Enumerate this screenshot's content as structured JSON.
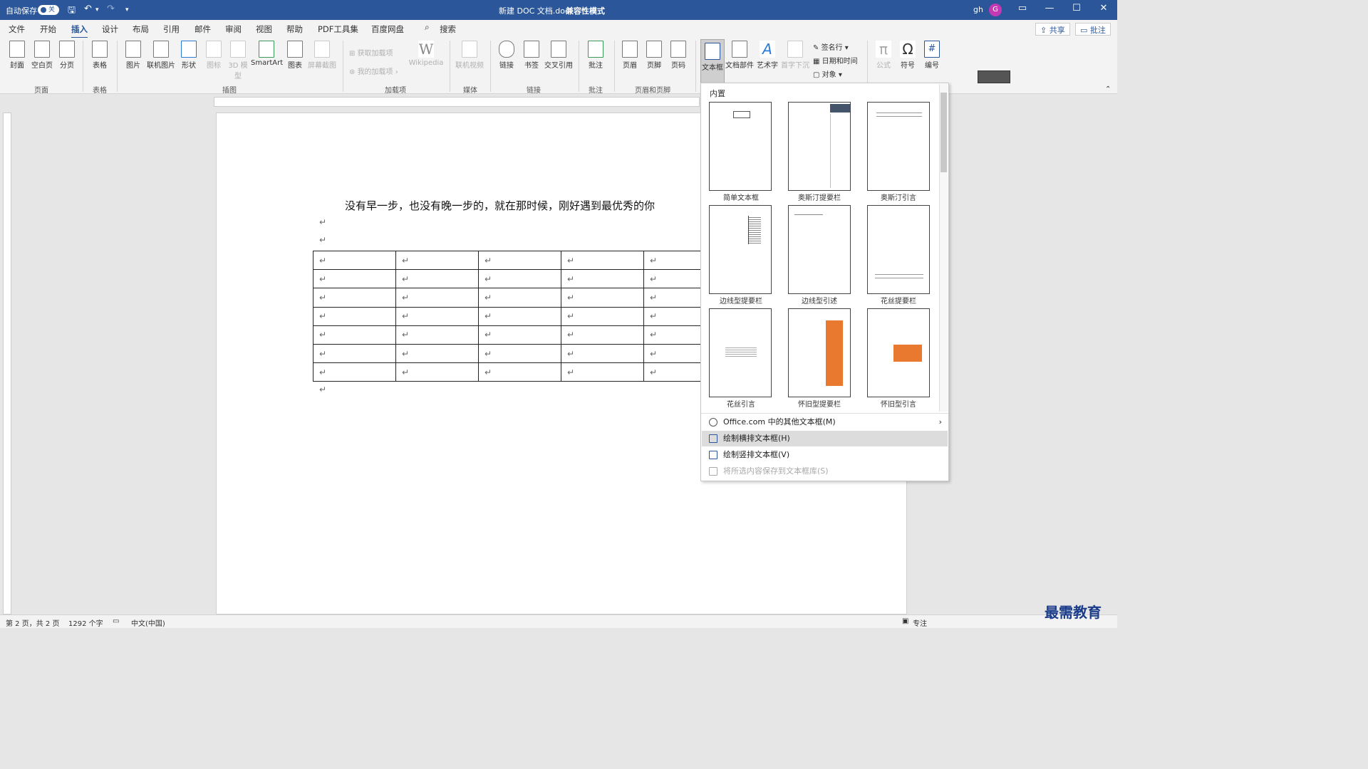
{
  "title_bar": {
    "autosave_label": "自动保存",
    "autosave_state": "关",
    "doc_title": "新建 DOC 文档.doc",
    "mode": "兼容性模式",
    "user": "gh",
    "avatar_letter": "G"
  },
  "menu": [
    "文件",
    "开始",
    "插入",
    "设计",
    "布局",
    "引用",
    "邮件",
    "审阅",
    "视图",
    "帮助",
    "PDF工具集",
    "百度网盘"
  ],
  "search_label": "搜索",
  "share_label": "共享",
  "comment_label": "批注",
  "ribbon": {
    "buttons": [
      {
        "label": "封面"
      },
      {
        "label": "空白页"
      },
      {
        "label": "分页"
      },
      {
        "label": "表格"
      },
      {
        "label": "图片"
      },
      {
        "label": "联机图片"
      },
      {
        "label": "形状"
      },
      {
        "label": "图标"
      },
      {
        "label": "3D 模型"
      },
      {
        "label": "SmartArt"
      },
      {
        "label": "图表"
      },
      {
        "label": "屏幕截图"
      },
      {
        "label": "Wikipedia"
      },
      {
        "label": "联机视频"
      },
      {
        "label": "链接"
      },
      {
        "label": "书签"
      },
      {
        "label": "交叉引用"
      },
      {
        "label": "批注"
      },
      {
        "label": "页眉"
      },
      {
        "label": "页脚"
      },
      {
        "label": "页码"
      },
      {
        "label": "文本框"
      },
      {
        "label": "文档部件"
      },
      {
        "label": "艺术字"
      },
      {
        "label": "首字下沉"
      },
      {
        "label": "公式"
      },
      {
        "label": "符号"
      },
      {
        "label": "编号"
      }
    ],
    "small": {
      "get_addins": "获取加载项",
      "my_addins": "我的加载项",
      "signature": "签名行",
      "datetime": "日期和时间",
      "object": "对象"
    },
    "groups": {
      "pages": "页面",
      "tables": "表格",
      "illustrations": "插图",
      "addins": "加载项",
      "media": "媒体",
      "links": "链接",
      "comments": "批注",
      "header_footer": "页眉和页脚"
    }
  },
  "document": {
    "text": "没有早一步，也没有晚一步的，就在那时候，刚好遇到最优秀的你",
    "para_mark": "↵",
    "table": {
      "rows": 7,
      "cols": 5
    }
  },
  "gallery": {
    "header": "内置",
    "items": [
      {
        "label": "简单文本框"
      },
      {
        "label": "奥斯汀提要栏"
      },
      {
        "label": "奥斯汀引言"
      },
      {
        "label": "边线型提要栏"
      },
      {
        "label": "边线型引述"
      },
      {
        "label": "花丝提要栏"
      },
      {
        "label": "花丝引言"
      },
      {
        "label": "怀旧型提要栏"
      },
      {
        "label": "怀旧型引言"
      }
    ],
    "menu": [
      {
        "label": "Office.com 中的其他文本框(M)",
        "arrow": "›"
      },
      {
        "label": "绘制横排文本框(H)"
      },
      {
        "label": "绘制竖排文本框(V)"
      },
      {
        "label": "将所选内容保存到文本框库(S)"
      }
    ]
  },
  "status": {
    "page": "第 2 页，共 2 页",
    "words": "1292 个字",
    "lang": "中文(中国)",
    "focus": "专注"
  },
  "watermark": "最需教育",
  "colors": {
    "titlebar": "#2b579a",
    "accent_orange": "#e8792e"
  }
}
